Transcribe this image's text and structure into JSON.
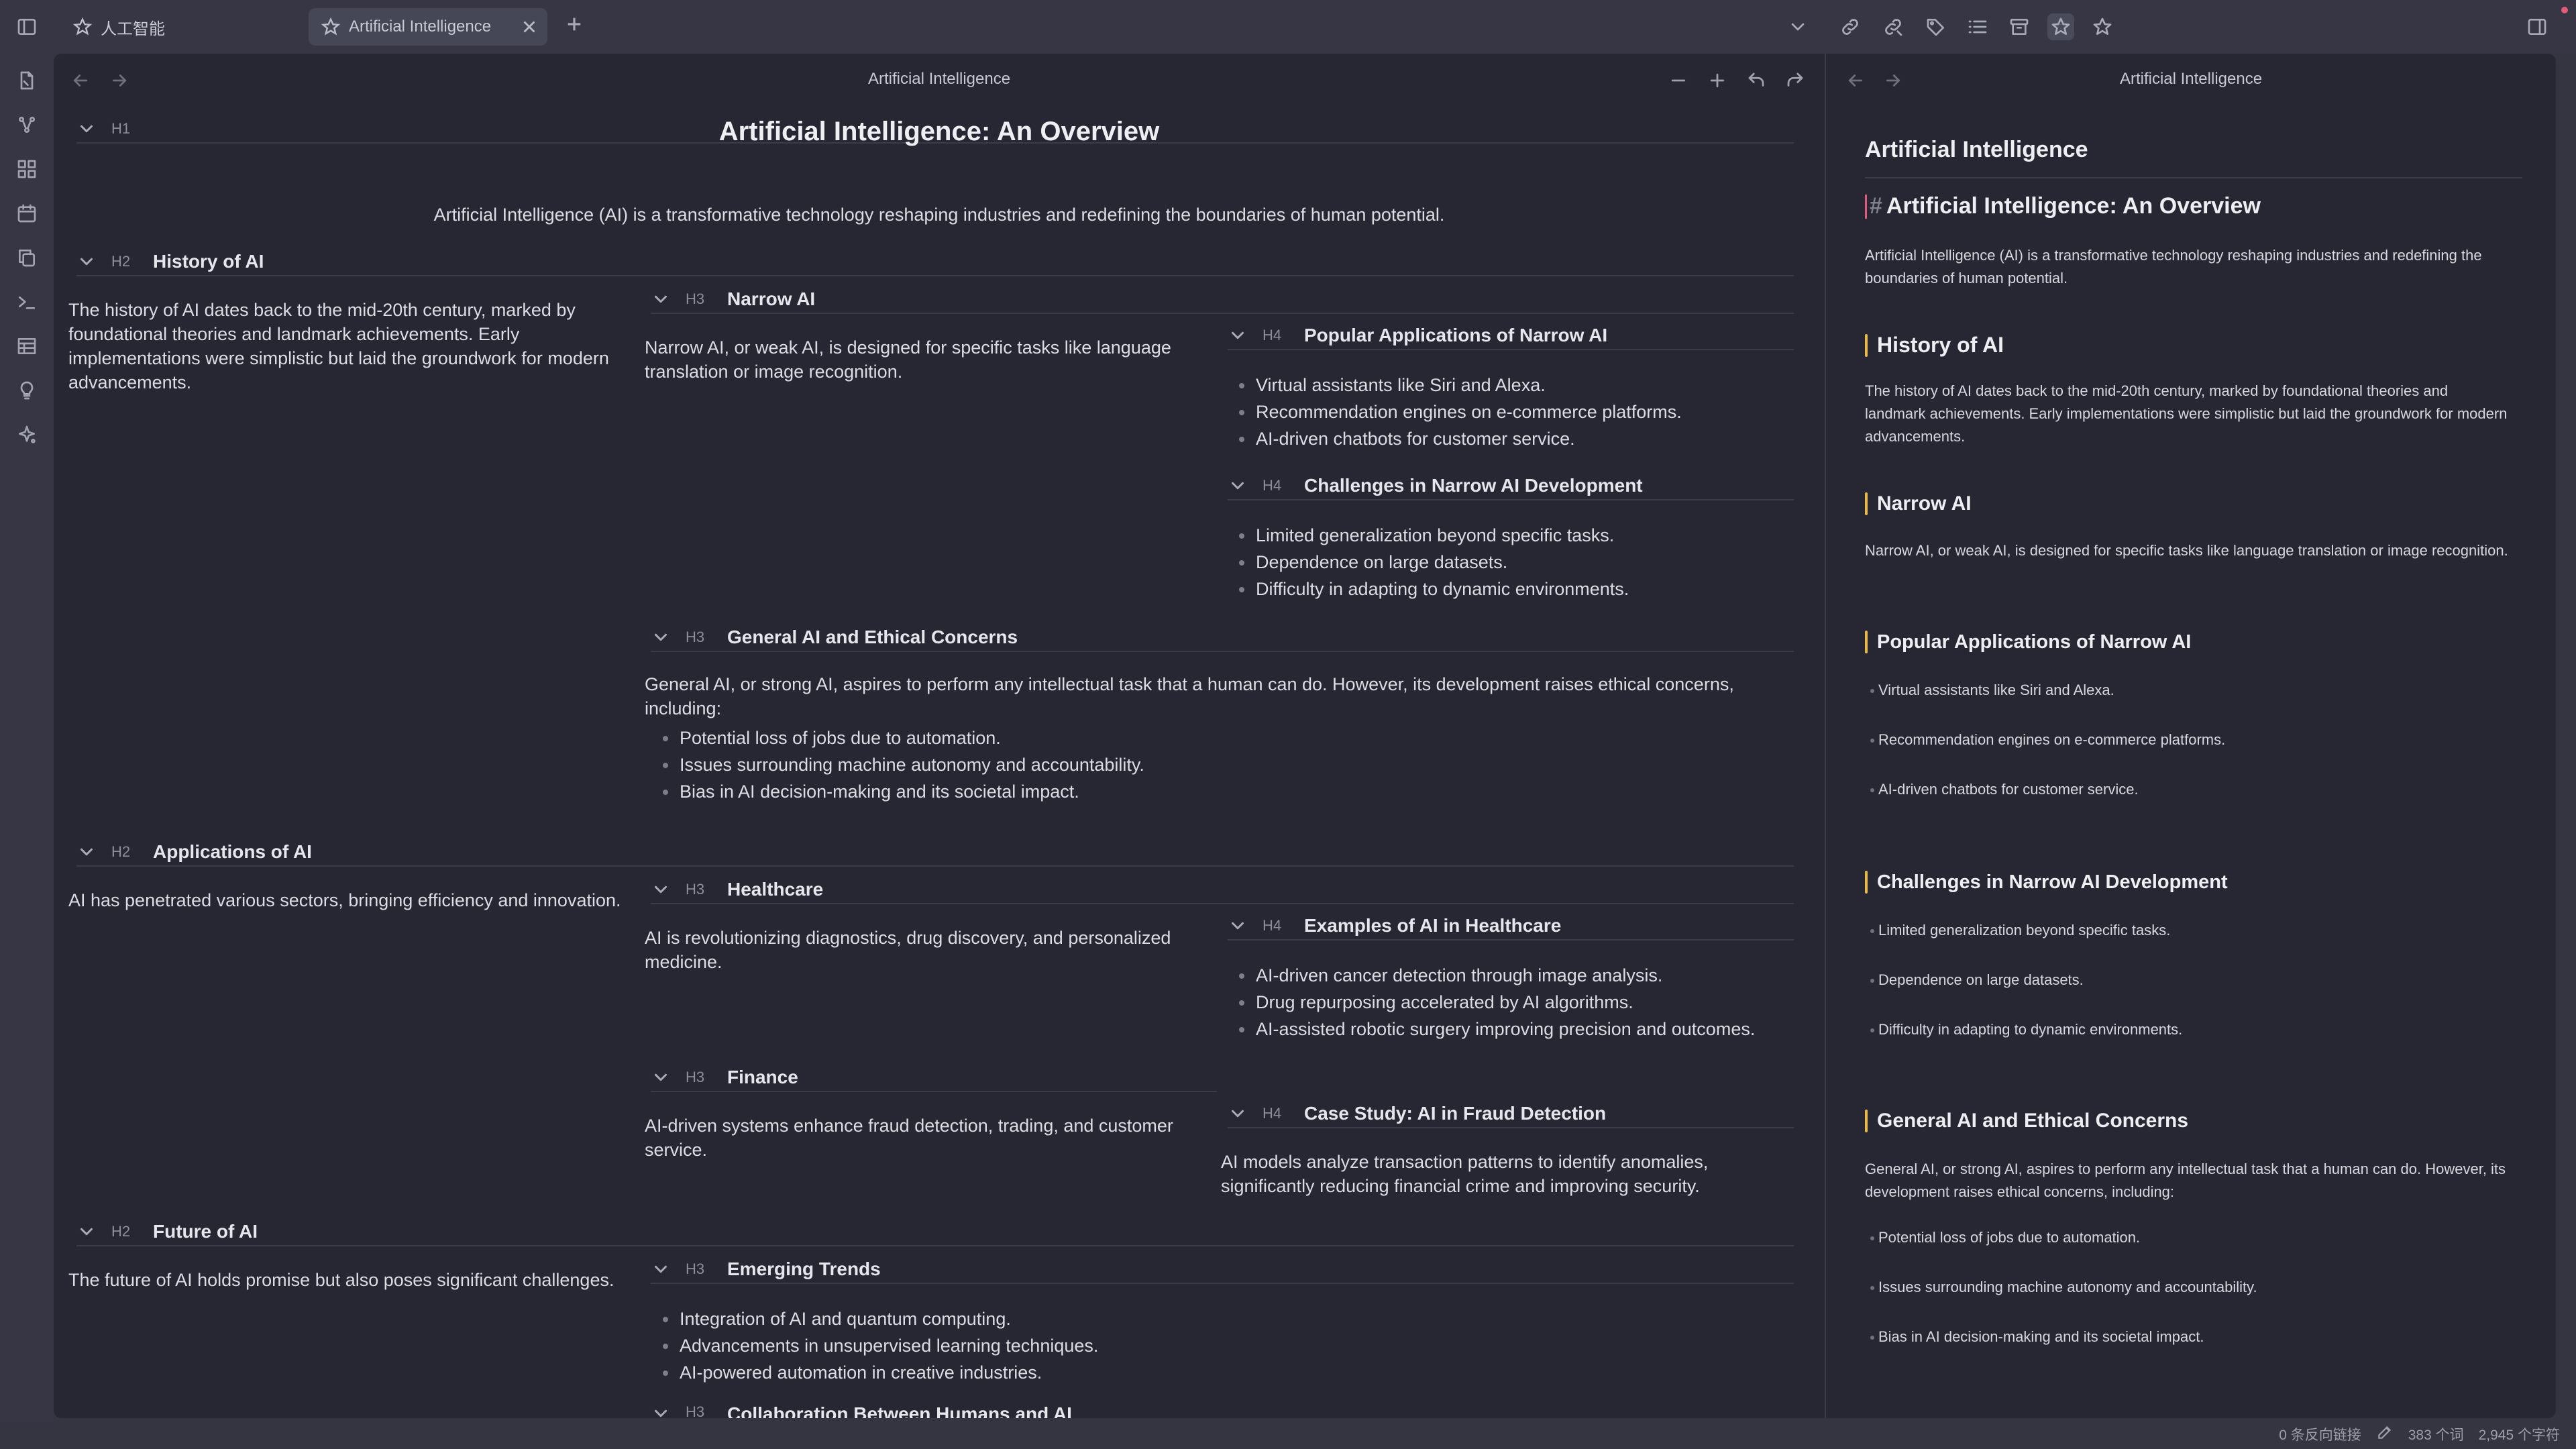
{
  "tabs": [
    {
      "label": "人工智能",
      "icon": "star-outline-icon",
      "active": false
    },
    {
      "label": "Artificial Intelligence",
      "icon": "star-outline-icon",
      "active": true
    }
  ],
  "toolbar_icons": [
    "chevron-down-icon",
    "link-icon",
    "link-out-icon",
    "tags-icon",
    "list-icon",
    "archive-icon",
    "star-filled-icon",
    "star-icon",
    "sidebar-right-icon"
  ],
  "ribbon_icons": [
    "files-icon",
    "graph-icon",
    "grid-icon",
    "calendar-icon",
    "copy-icon",
    "terminal-icon",
    "table-icon",
    "lightbulb-icon",
    "sparkle-icon"
  ],
  "left_pane": {
    "title": "Artificial Intelligence",
    "mindmap": {
      "h1": {
        "level": "H1",
        "text": "Artificial Intelligence: An Overview"
      },
      "intro": "Artificial Intelligence (AI) is a transformative technology reshaping industries and redefining the boundaries of human potential.",
      "history": {
        "level": "H2",
        "text": "History of AI",
        "body": "The history of AI dates back to the mid-20th century, marked by foundational theories and landmark achievements. Early implementations were simplistic but laid the groundwork for modern advancements.",
        "narrow": {
          "level": "H3",
          "text": "Narrow AI",
          "body": "Narrow AI, or weak AI, is designed for specific tasks like language translation or image recognition.",
          "popular": {
            "level": "H4",
            "text": "Popular Applications of Narrow AI",
            "items": [
              "Virtual assistants like Siri and Alexa.",
              "Recommendation engines on e-commerce platforms.",
              "AI-driven chatbots for customer service."
            ]
          },
          "challenges": {
            "level": "H4",
            "text": "Challenges in Narrow AI Development",
            "items": [
              "Limited generalization beyond specific tasks.",
              "Dependence on large datasets.",
              "Difficulty in adapting to dynamic environments."
            ]
          }
        },
        "general": {
          "level": "H3",
          "text": "General AI and Ethical Concerns",
          "body": "General AI, or strong AI, aspires to perform any intellectual task that a human can do. However, its development raises ethical concerns, including:",
          "items": [
            "Potential loss of jobs due to automation.",
            "Issues surrounding machine autonomy and accountability.",
            "Bias in AI decision-making and its societal impact."
          ]
        }
      },
      "applications": {
        "level": "H2",
        "text": "Applications of AI",
        "body": "AI has penetrated various sectors, bringing efficiency and innovation.",
        "healthcare": {
          "level": "H3",
          "text": "Healthcare",
          "body": "AI is revolutionizing diagnostics, drug discovery, and personalized medicine.",
          "examples": {
            "level": "H4",
            "text": "Examples of AI in Healthcare",
            "items": [
              "AI-driven cancer detection through image analysis.",
              "Drug repurposing accelerated by AI algorithms.",
              "AI-assisted robotic surgery improving precision and outcomes."
            ]
          }
        },
        "finance": {
          "level": "H3",
          "text": "Finance",
          "body": "AI-driven systems enhance fraud detection, trading, and customer service.",
          "case": {
            "level": "H4",
            "text": "Case Study: AI in Fraud Detection",
            "body": "AI models analyze transaction patterns to identify anomalies, significantly reducing financial crime and improving security."
          }
        }
      },
      "future": {
        "level": "H2",
        "text": "Future of AI",
        "body": "The future of AI holds promise but also poses significant challenges.",
        "trends": {
          "level": "H3",
          "text": "Emerging Trends",
          "items": [
            "Integration of AI and quantum computing.",
            "Advancements in unsupervised learning techniques.",
            "AI-powered automation in creative industries."
          ]
        },
        "collab": {
          "level": "H3",
          "text": "Collaboration Between Humans and AI"
        }
      }
    }
  },
  "right_pane": {
    "title": "Artificial Intelligence",
    "doc_title": "Artificial Intelligence",
    "h1_marker": "#",
    "h1": "Artificial Intelligence: An Overview",
    "intro": "Artificial Intelligence (AI) is a transformative technology reshaping industries and redefining the boundaries of human potential.",
    "history_h": "History of AI",
    "history_p": "The history of AI dates back to the mid-20th century, marked by foundational theories and landmark achievements. Early implementations were simplistic but laid the groundwork for modern advancements.",
    "narrow_h": "Narrow AI",
    "narrow_p": "Narrow AI, or weak AI, is designed for specific tasks like language translation or image recognition.",
    "popular_h": "Popular Applications of Narrow AI",
    "popular_items": [
      "Virtual assistants like Siri and Alexa.",
      "Recommendation engines on e-commerce platforms.",
      "AI-driven chatbots for customer service."
    ],
    "challenges_h": "Challenges in Narrow AI Development",
    "challenges_items": [
      "Limited generalization beyond specific tasks.",
      "Dependence on large datasets.",
      "Difficulty in adapting to dynamic environments."
    ],
    "general_h": "General AI and Ethical Concerns",
    "general_p": "General AI, or strong AI, aspires to perform any intellectual task that a human can do. However, its development raises ethical concerns, including:",
    "general_items": [
      "Potential loss of jobs due to automation.",
      "Issues surrounding machine autonomy and accountability.",
      "Bias in AI decision-making and its societal impact."
    ]
  },
  "status_bar": {
    "backlinks": "0 条反向链接",
    "words": "383 个词",
    "chars": "2,945 个字符"
  },
  "colors": {
    "accent_heading_bar": "#e8b94a",
    "cursor": "#e05a7a",
    "pane_bg": "#272734",
    "chrome_bg": "#363644"
  }
}
